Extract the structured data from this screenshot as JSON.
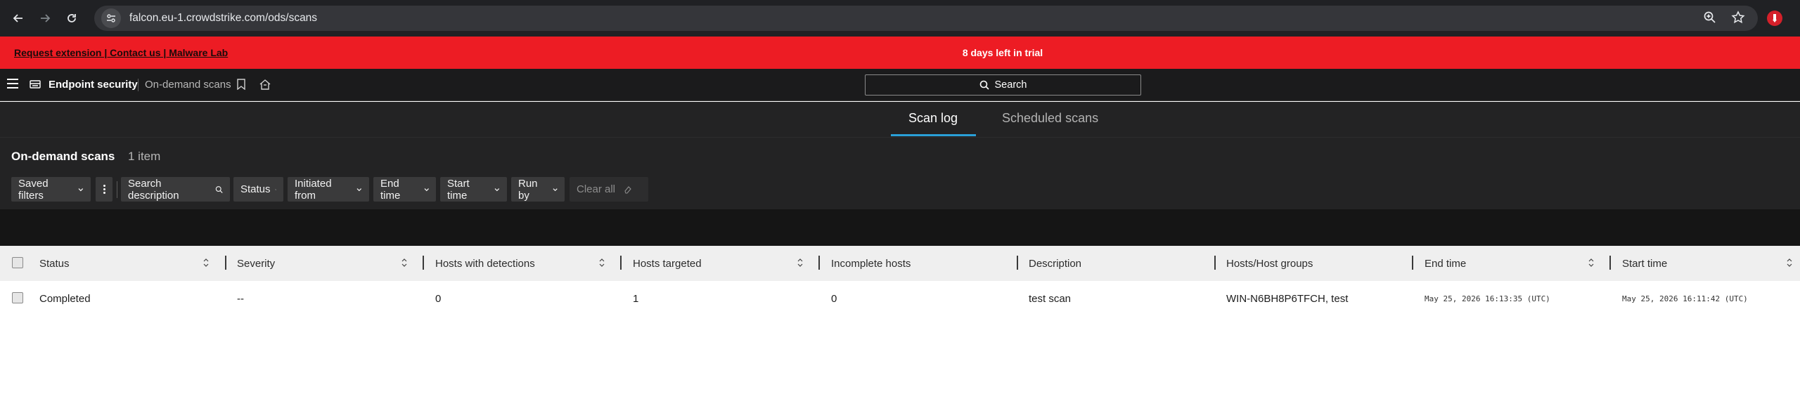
{
  "browser": {
    "url": "falcon.eu-1.crowdstrike.com/ods/scans"
  },
  "banner": {
    "links": "Request extension | Contact us | Malware Lab",
    "trial_text": "8 days left in trial",
    "color": "#ed1c24"
  },
  "header": {
    "product": "Endpoint security",
    "crumb": "On-demand scans",
    "search_label": "Search"
  },
  "tabs": [
    {
      "label": "Scan log",
      "active": true
    },
    {
      "label": "Scheduled scans",
      "active": false
    }
  ],
  "page": {
    "title": "On-demand scans",
    "count": "1 item"
  },
  "filters": {
    "saved": "Saved filters",
    "search_description": "Search description",
    "status": "Status",
    "initiated_from": "Initiated from",
    "end_time": "End time",
    "start_time": "Start time",
    "run_by": "Run by",
    "clear_all": "Clear all"
  },
  "table": {
    "columns": [
      "Status",
      "Severity",
      "Hosts with detections",
      "Hosts targeted",
      "Incomplete hosts",
      "Description",
      "Hosts/Host groups",
      "End time",
      "Start time"
    ],
    "rows": [
      [
        "Completed",
        "--",
        "0",
        "1",
        "0",
        "test scan",
        "WIN-N6BH8P6TFCH, test",
        "May 25, 2026 16:13:35 (UTC)",
        "May 25, 2026 16:11:42 (UTC)"
      ]
    ]
  },
  "colors": {
    "accent": "#2aa0d8",
    "app_bg": "#232324"
  }
}
